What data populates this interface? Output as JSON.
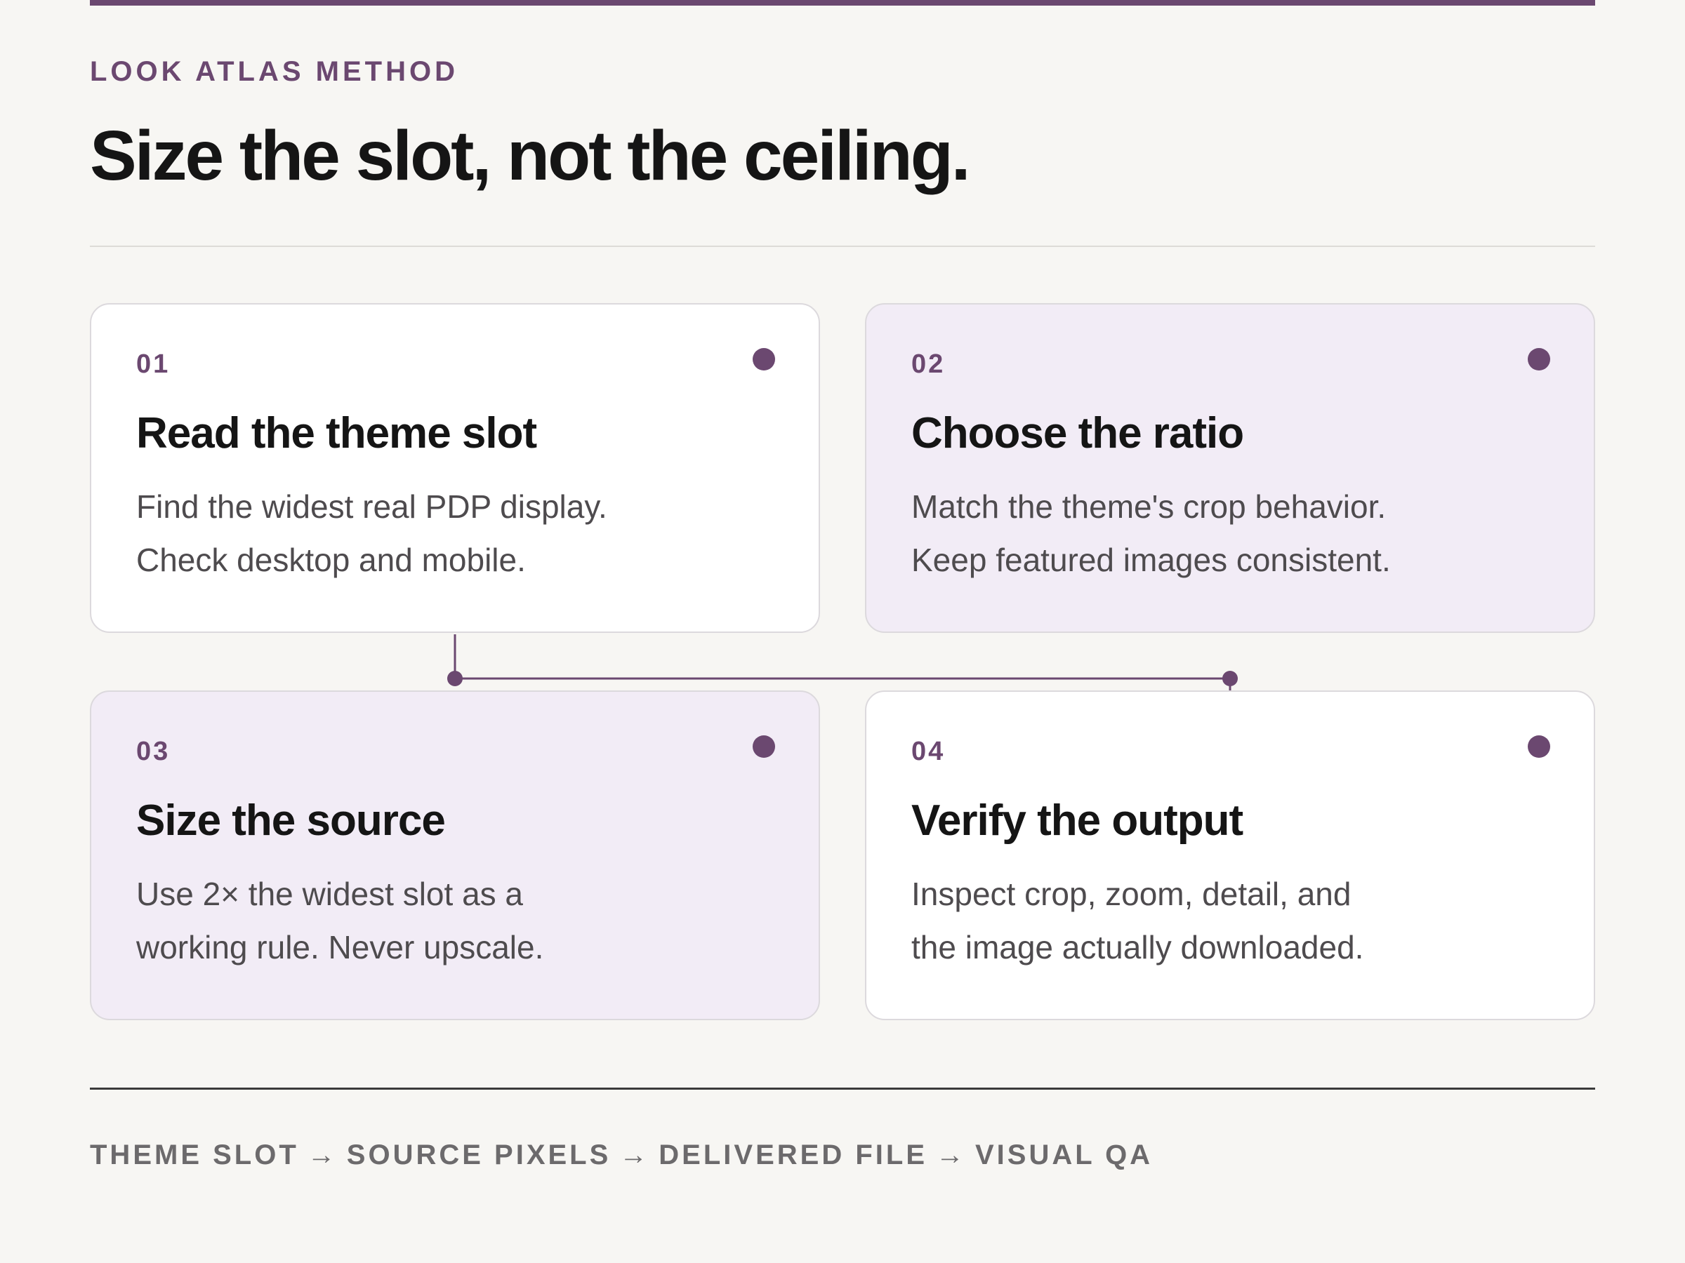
{
  "header": {
    "eyebrow": "LOOK ATLAS METHOD",
    "title": "Size the slot, not the ceiling."
  },
  "steps": [
    {
      "number": "01",
      "title": "Read the theme slot",
      "lines": [
        "Find the widest real PDP display.",
        "Check desktop and mobile."
      ]
    },
    {
      "number": "02",
      "title": "Choose the ratio",
      "lines": [
        "Match the theme's crop behavior.",
        "Keep featured images consistent."
      ]
    },
    {
      "number": "03",
      "title": "Size the source",
      "lines": [
        "Use 2× the widest slot as a",
        "working rule. Never upscale."
      ]
    },
    {
      "number": "04",
      "title": "Verify the output",
      "lines": [
        "Inspect crop, zoom, detail, and",
        "the image actually downloaded."
      ]
    }
  ],
  "flow": {
    "stages": [
      "THEME SLOT",
      "SOURCE PIXELS",
      "DELIVERED FILE",
      "VISUAL QA"
    ],
    "separator": "→"
  },
  "colors": {
    "accent": "#6b4870",
    "background": "#f7f6f3",
    "card_white": "#ffffff",
    "card_tint": "#f2ecf6",
    "text_dark": "#151515",
    "text_body": "#4e4b4e",
    "text_muted": "#6c6a6c"
  }
}
